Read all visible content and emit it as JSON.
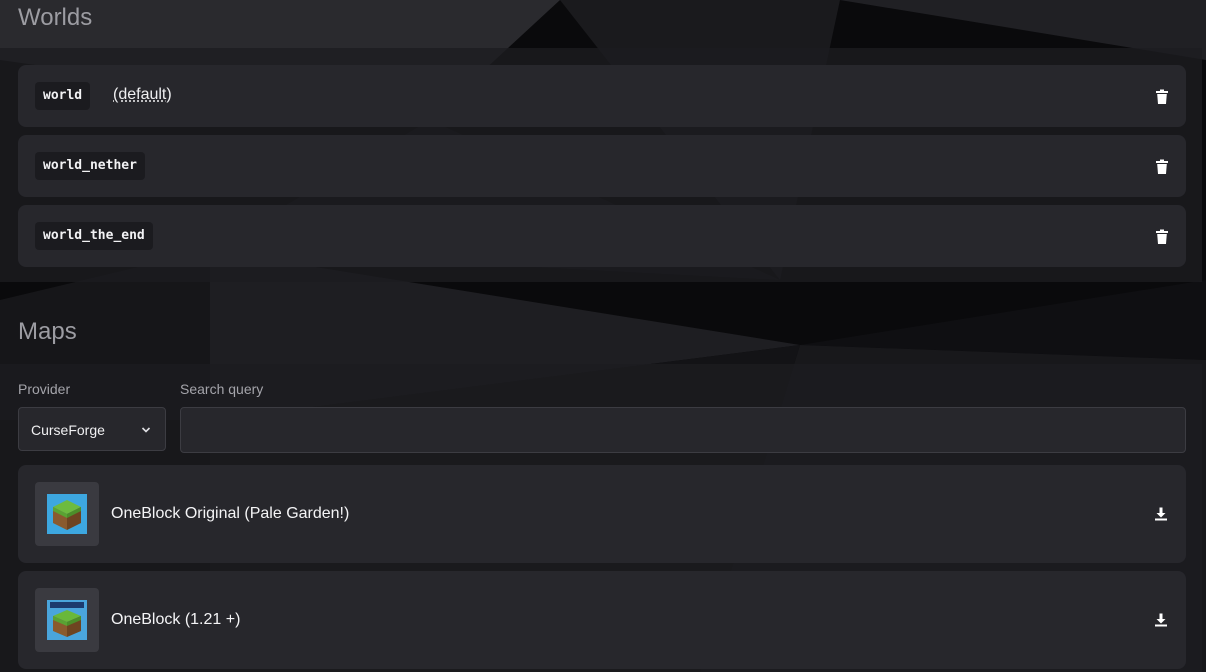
{
  "worlds": {
    "title": "Worlds",
    "items": [
      {
        "name": "world",
        "tag": "(default)",
        "action_icon": "trash-icon"
      },
      {
        "name": "world_nether",
        "tag": "",
        "action_icon": "trash-icon"
      },
      {
        "name": "world_the_end",
        "tag": "",
        "action_icon": "trash-icon"
      }
    ]
  },
  "maps": {
    "title": "Maps",
    "provider_label": "Provider",
    "provider_value": "CurseForge",
    "search_label": "Search query",
    "search_value": "",
    "results": [
      {
        "title": "OneBlock Original (Pale Garden!)",
        "thumb_icon": "grass-block-icon",
        "action_icon": "download-icon"
      },
      {
        "title": "OneBlock (1.21 +)",
        "thumb_icon": "oneblock-logo-icon",
        "action_icon": "download-icon"
      }
    ]
  },
  "colors": {
    "card": "#27272c",
    "panel": "#1c1c20",
    "text": "#f0f0f2",
    "muted": "#9c9ca2"
  }
}
